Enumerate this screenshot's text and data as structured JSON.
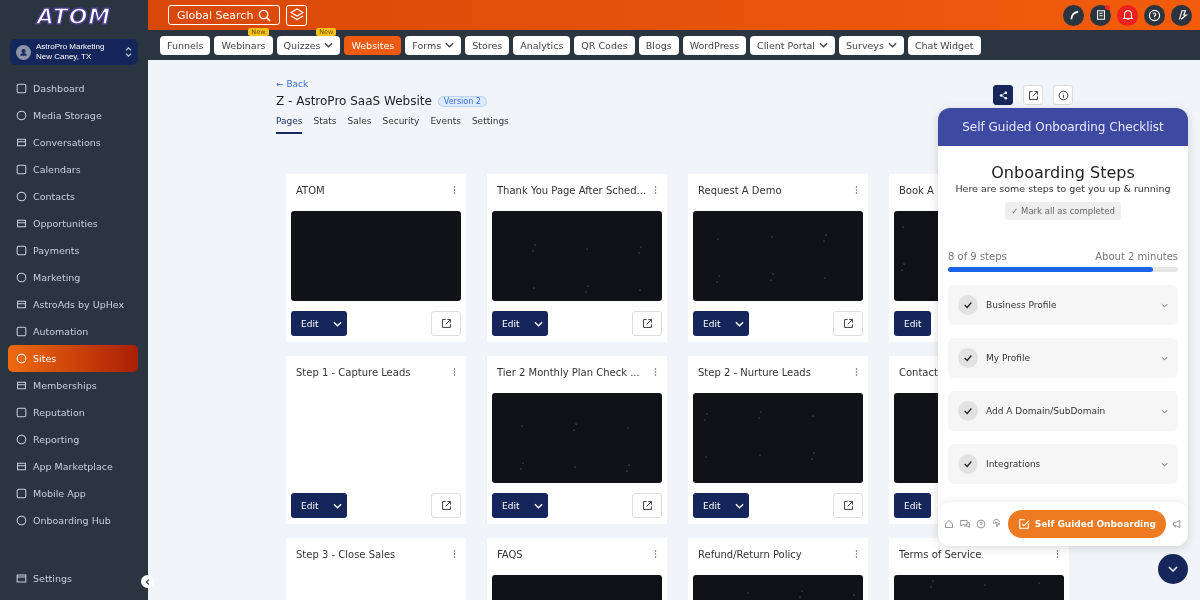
{
  "logo": {
    "text": "ATOM"
  },
  "account": {
    "name": "AstroPro Marketing",
    "location": "New Caney, TX"
  },
  "sidebar": {
    "items": [
      {
        "label": "Dashboard",
        "selected": false
      },
      {
        "label": "Media Storage",
        "selected": false
      },
      {
        "label": "Conversations",
        "selected": false
      },
      {
        "label": "Calendars",
        "selected": false
      },
      {
        "label": "Contacts",
        "selected": false
      },
      {
        "label": "Opportunities",
        "selected": false
      },
      {
        "label": "Payments",
        "selected": false
      },
      {
        "label": "Marketing",
        "selected": false
      },
      {
        "label": "AstroAds by UpHex",
        "selected": false
      },
      {
        "label": "Automation",
        "selected": false
      },
      {
        "label": "Sites",
        "selected": true
      },
      {
        "label": "Memberships",
        "selected": false
      },
      {
        "label": "Reputation",
        "selected": false
      },
      {
        "label": "Reporting",
        "selected": false
      },
      {
        "label": "App Marketplace",
        "selected": false
      },
      {
        "label": "Mobile App",
        "selected": false
      },
      {
        "label": "Onboarding Hub",
        "selected": false
      }
    ],
    "settings": "Settings"
  },
  "topbar": {
    "search": "Global Search"
  },
  "nav": [
    {
      "label": "Funnels",
      "selected": false
    },
    {
      "label": "Webinars",
      "selected": false,
      "badge": "New"
    },
    {
      "label": "Quizzes",
      "selected": false,
      "badge": "New",
      "dropdown": true
    },
    {
      "label": "Websites",
      "selected": true
    },
    {
      "label": "Forms",
      "selected": false,
      "dropdown": true
    },
    {
      "label": "Stores",
      "selected": false
    },
    {
      "label": "Analytics",
      "selected": false
    },
    {
      "label": "QR Codes",
      "selected": false
    },
    {
      "label": "Blogs",
      "selected": false
    },
    {
      "label": "WordPress",
      "selected": false
    },
    {
      "label": "Client Portal",
      "selected": false,
      "dropdown": true
    },
    {
      "label": "Surveys",
      "selected": false,
      "dropdown": true
    },
    {
      "label": "Chat Widget",
      "selected": false
    }
  ],
  "header": {
    "back": "← Back",
    "title": "Z - AstroPro SaaS Website",
    "version": "Version 2"
  },
  "tabs": [
    {
      "label": "Pages",
      "selected": true
    },
    {
      "label": "Stats",
      "selected": false
    },
    {
      "label": "Sales",
      "selected": false
    },
    {
      "label": "Security",
      "selected": false
    },
    {
      "label": "Events",
      "selected": false
    },
    {
      "label": "Settings",
      "selected": false
    }
  ],
  "pages": [
    {
      "title": "ATOM",
      "thumbnail": true,
      "edit": "Edit",
      "edit_dropdown": true
    },
    {
      "title": "Thank You Page After Sched...",
      "thumbnail": true,
      "edit": "Edit",
      "edit_dropdown": true
    },
    {
      "title": "Request A Demo",
      "thumbnail": true,
      "edit": "Edit",
      "edit_dropdown": true
    },
    {
      "title": "Book A",
      "thumbnail": true,
      "edit": "Edit"
    },
    {
      "title": "Step 1 - Capture Leads",
      "thumbnail": false,
      "edit": "Edit",
      "edit_dropdown": true
    },
    {
      "title": "Tier 2 Monthly Plan Check ...",
      "thumbnail": true,
      "edit": "Edit",
      "edit_dropdown": true
    },
    {
      "title": "Step 2 - Nurture Leads",
      "thumbnail": true,
      "edit": "Edit",
      "edit_dropdown": true
    },
    {
      "title": "Contact",
      "thumbnail": true,
      "edit": "Edit"
    },
    {
      "title": "Step 3 - Close Sales",
      "thumbnail": false
    },
    {
      "title": "FAQS",
      "thumbnail": true
    },
    {
      "title": "Refund/Return Policy",
      "thumbnail": true
    },
    {
      "title": "Terms of Service",
      "thumbnail": true
    }
  ],
  "onboarding": {
    "header": "Self Guided Onboarding Checklist",
    "title": "Onboarding Steps",
    "subtitle": "Here are some steps to get you up & running",
    "mark_all": "✓ Mark all as completed",
    "progress_text": "8 of 9 steps",
    "time": "About 2 minutes",
    "level": 0.89,
    "steps": [
      {
        "label": "Business Profile",
        "checked": true
      },
      {
        "label": "My Profile",
        "checked": true
      },
      {
        "label": "Add A Domain/SubDomain",
        "checked": true
      },
      {
        "label": "Integrations",
        "checked": true
      }
    ],
    "footer_button": "Self Guided Onboarding"
  }
}
